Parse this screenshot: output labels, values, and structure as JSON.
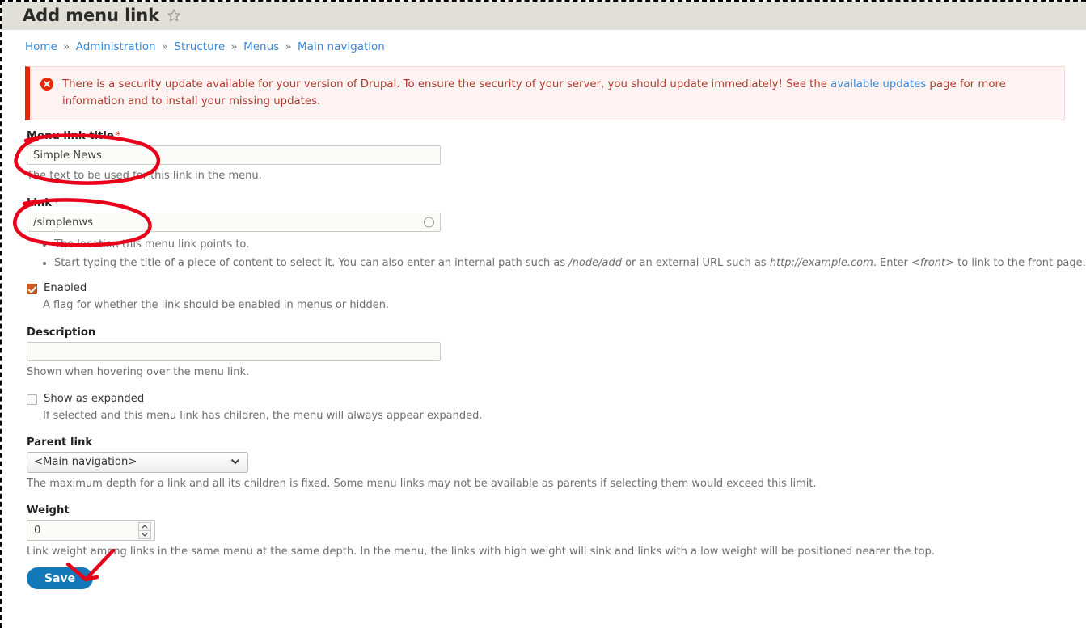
{
  "window": {
    "title": "Add menu link",
    "star_icon": "star-outline-icon"
  },
  "breadcrumb": {
    "separator": "»",
    "items": [
      {
        "label": "Home"
      },
      {
        "label": "Administration"
      },
      {
        "label": "Structure"
      },
      {
        "label": "Menus"
      },
      {
        "label": "Main navigation"
      }
    ]
  },
  "message": {
    "icon": "error-circle-x-icon",
    "text_before_link": "There is a security update available for your version of Drupal. To ensure the security of your server, you should update immediately! See the ",
    "link_label": "available updates",
    "text_after_link": " page for more information and to install your missing updates.",
    "accent_color": "#e62600",
    "background_color": "#fdf3f2",
    "text_color": "#b03b2e",
    "link_color": "#3b89d6"
  },
  "form": {
    "menu_link_title": {
      "label": "Menu link title",
      "required_marker": "*",
      "value": "Simple News",
      "placeholder": "",
      "description": "The text to be used for this link in the menu."
    },
    "link": {
      "label": "Link",
      "required_marker": "*",
      "value": "/simplenws",
      "placeholder": "",
      "throbber_icon": "circle-throbber-icon",
      "descriptions": [
        "The location this menu link points to.",
        "Start typing the title of a piece of content to select it. You can also enter an internal path such as /node/add or an external URL such as http://example.com. Enter <front> to link to the front page."
      ],
      "desc2_parts": {
        "p1": "Start typing the title of a piece of content to select it. You can also enter an internal path such as ",
        "em1": "/node/add",
        "p2": " or an external URL such as ",
        "em2": "http://example.com",
        "p3": ". Enter ",
        "em3": "<front>",
        "p4": " to link to the front page."
      }
    },
    "enabled": {
      "label": "Enabled",
      "checked": true,
      "description": "A flag for whether the link should be enabled in menus or hidden."
    },
    "description_field": {
      "label": "Description",
      "value": "",
      "placeholder": "",
      "description": "Shown when hovering over the menu link."
    },
    "show_expanded": {
      "label": "Show as expanded",
      "checked": false,
      "description": "If selected and this menu link has children, the menu will always appear expanded."
    },
    "parent_link": {
      "label": "Parent link",
      "selected": "<Main navigation>",
      "options": [
        "<Main navigation>"
      ],
      "chevron_icon": "chevron-down-icon",
      "description": "The maximum depth for a link and all its children is fixed. Some menu links may not be available as parents if selecting them would exceed this limit."
    },
    "weight": {
      "label": "Weight",
      "value": "0",
      "stepper_up_icon": "chevron-up-icon",
      "stepper_down_icon": "chevron-down-icon",
      "description": "Link weight among links in the same menu at the same depth. In the menu, the links with high weight will sink and links with a low weight will be positioned nearer the top."
    },
    "save_button": {
      "label": "Save",
      "color": "#1278b8"
    }
  },
  "annotations": {
    "color": "#e8001b",
    "shapes": [
      {
        "name": "ellipse-around-menu-link-title",
        "type": "ellipse"
      },
      {
        "name": "ellipse-around-link-field",
        "type": "ellipse"
      },
      {
        "name": "arrow-to-save-button",
        "type": "arrow"
      }
    ]
  }
}
